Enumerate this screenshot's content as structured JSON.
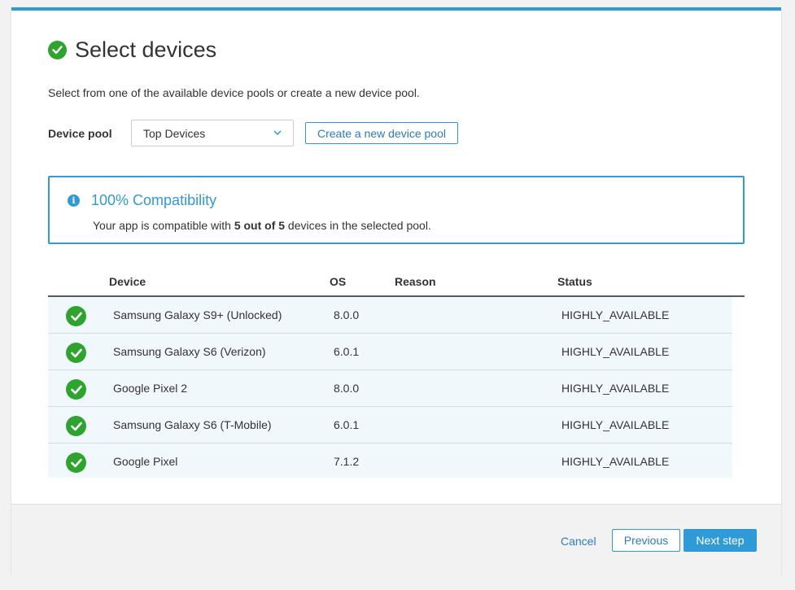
{
  "header": {
    "title": "Select devices"
  },
  "intro": "Select from one of the available device pools or create a new device pool.",
  "device_pool": {
    "label": "Device pool",
    "selected": "Top Devices",
    "create_label": "Create a new device pool"
  },
  "compatibility": {
    "title": "100% Compatibility",
    "text_before": "Your app is compatible with ",
    "text_bold": "5 out of 5",
    "text_after": " devices in the selected pool."
  },
  "table": {
    "columns": {
      "device": "Device",
      "os": "OS",
      "reason": "Reason",
      "status": "Status"
    },
    "rows": [
      {
        "device": "Samsung Galaxy S9+ (Unlocked)",
        "os": "8.0.0",
        "reason": "",
        "status": "HIGHLY_AVAILABLE"
      },
      {
        "device": "Samsung Galaxy S6 (Verizon)",
        "os": "6.0.1",
        "reason": "",
        "status": "HIGHLY_AVAILABLE"
      },
      {
        "device": "Google Pixel 2",
        "os": "8.0.0",
        "reason": "",
        "status": "HIGHLY_AVAILABLE"
      },
      {
        "device": "Samsung Galaxy S6 (T-Mobile)",
        "os": "6.0.1",
        "reason": "",
        "status": "HIGHLY_AVAILABLE"
      },
      {
        "device": "Google Pixel",
        "os": "7.1.2",
        "reason": "",
        "status": "HIGHLY_AVAILABLE"
      }
    ]
  },
  "footer": {
    "cancel": "Cancel",
    "previous": "Previous",
    "next": "Next step"
  },
  "colors": {
    "accent": "#2e9ad6",
    "success": "#2ea42e"
  },
  "icons": {
    "title": "check-circle-icon",
    "info": "info-icon",
    "row": "check-circle-icon",
    "dropdown": "chevron-down-icon"
  }
}
